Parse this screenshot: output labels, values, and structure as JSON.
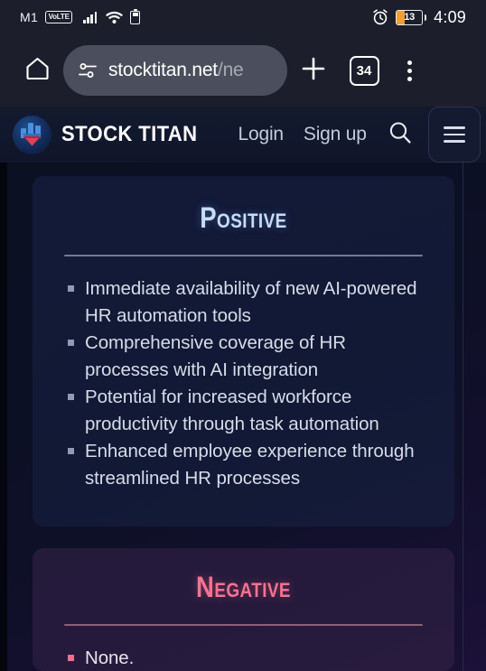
{
  "status_bar": {
    "carrier": "M1",
    "network_badge": "VoLTE",
    "signal_icon": "signal-bars-icon",
    "wifi_icon": "wifi-icon",
    "sim_battery_icon": "sim-battery-icon",
    "alarm_icon": "alarm-clock-icon",
    "battery_level": "13",
    "battery_color": "#f0a030",
    "time": "4:09"
  },
  "browser": {
    "home_icon": "home-icon",
    "permissions_icon": "page-settings-icon",
    "url_main": "stocktitan.net",
    "url_truncated": "/ne",
    "url_full": "stocktitan.net/ne",
    "new_tab_icon": "plus-icon",
    "tab_count": "34",
    "overflow_icon": "three-dot-menu-icon"
  },
  "site_header": {
    "logo_icon": "stock-titan-logo-icon",
    "brand": "STOCK TITAN",
    "login": "Login",
    "signup": "Sign up",
    "search_icon": "search-icon",
    "menu_icon": "hamburger-menu-icon"
  },
  "content": {
    "positive": {
      "title": "Positive",
      "accent_color": "#c7ddf7",
      "items": [
        "Immediate availability of new AI-powered HR automation tools",
        "Comprehensive coverage of HR processes with AI integration",
        "Potential for increased workforce productivity through task automation",
        "Enhanced employee experience through streamlined HR processes"
      ]
    },
    "negative": {
      "title": "Negative",
      "accent_color": "#f8728f",
      "items": [
        "None."
      ]
    }
  }
}
